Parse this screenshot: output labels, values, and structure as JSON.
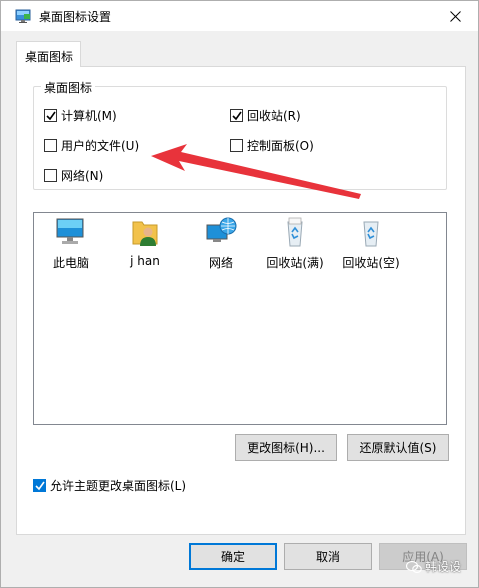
{
  "window": {
    "title": "桌面图标设置",
    "close_icon": "close-icon"
  },
  "tab": {
    "label": "桌面图标"
  },
  "group": {
    "label": "桌面图标",
    "checkboxes": [
      {
        "label": "计算机(M)",
        "checked": true
      },
      {
        "label": "回收站(R)",
        "checked": true
      },
      {
        "label": "用户的文件(U)",
        "checked": false
      },
      {
        "label": "控制面板(O)",
        "checked": false
      },
      {
        "label": "网络(N)",
        "checked": false
      }
    ]
  },
  "icons": [
    {
      "label": "此电脑",
      "icon": "computer-icon"
    },
    {
      "label": "j han",
      "icon": "user-folder-icon"
    },
    {
      "label": "网络",
      "icon": "network-icon"
    },
    {
      "label": "回收站(满)",
      "icon": "recycle-bin-full-icon"
    },
    {
      "label": "回收站(空)",
      "icon": "recycle-bin-empty-icon"
    }
  ],
  "buttons": {
    "change_icon": "更改图标(H)...",
    "restore_default": "还原默认值(S)",
    "ok": "确定",
    "cancel": "取消",
    "apply": "应用(A)"
  },
  "theme_checkbox": {
    "label": "允许主题更改桌面图标(L)",
    "checked": true
  },
  "watermark": "韩设设",
  "colors": {
    "accent": "#0078d7",
    "annotation_arrow": "#e8333b"
  }
}
